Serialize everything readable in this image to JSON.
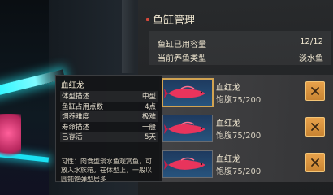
{
  "panel": {
    "title": "鱼缸管理",
    "summary": {
      "capacity_label": "鱼缸已用容量",
      "capacity_value": "12/12",
      "type_label": "当前养鱼类型",
      "type_value": "淡水鱼"
    },
    "fish_list": [
      {
        "name": "血红龙",
        "satiety": "饱腹75/200"
      },
      {
        "name": "血红龙",
        "satiety": "饱腹75/200"
      },
      {
        "name": "血红龙",
        "satiety": "饱腹75/200"
      }
    ]
  },
  "tooltip": {
    "title": "血红龙",
    "rows": [
      {
        "key": "体型描述",
        "value": "中型"
      },
      {
        "key": "鱼缸占用点数",
        "value": "4点"
      },
      {
        "key": "饲养难度",
        "value": "极难"
      },
      {
        "key": "寿命描述",
        "value": "一般"
      },
      {
        "key": "已存活",
        "value": "5天"
      }
    ],
    "description": "习性：肉食型淡水鱼观赏鱼，可放入水族箱。在体型上，一般以圆钝饱弹型居多"
  },
  "colors": {
    "accent_orange": "#e8a24b",
    "title_dot": "#d6483b",
    "fish_red": "#e8345c",
    "tank_glow": "#26f6ff"
  },
  "icons": {
    "remove": "close-icon",
    "fish": "arowana-fish-icon"
  }
}
